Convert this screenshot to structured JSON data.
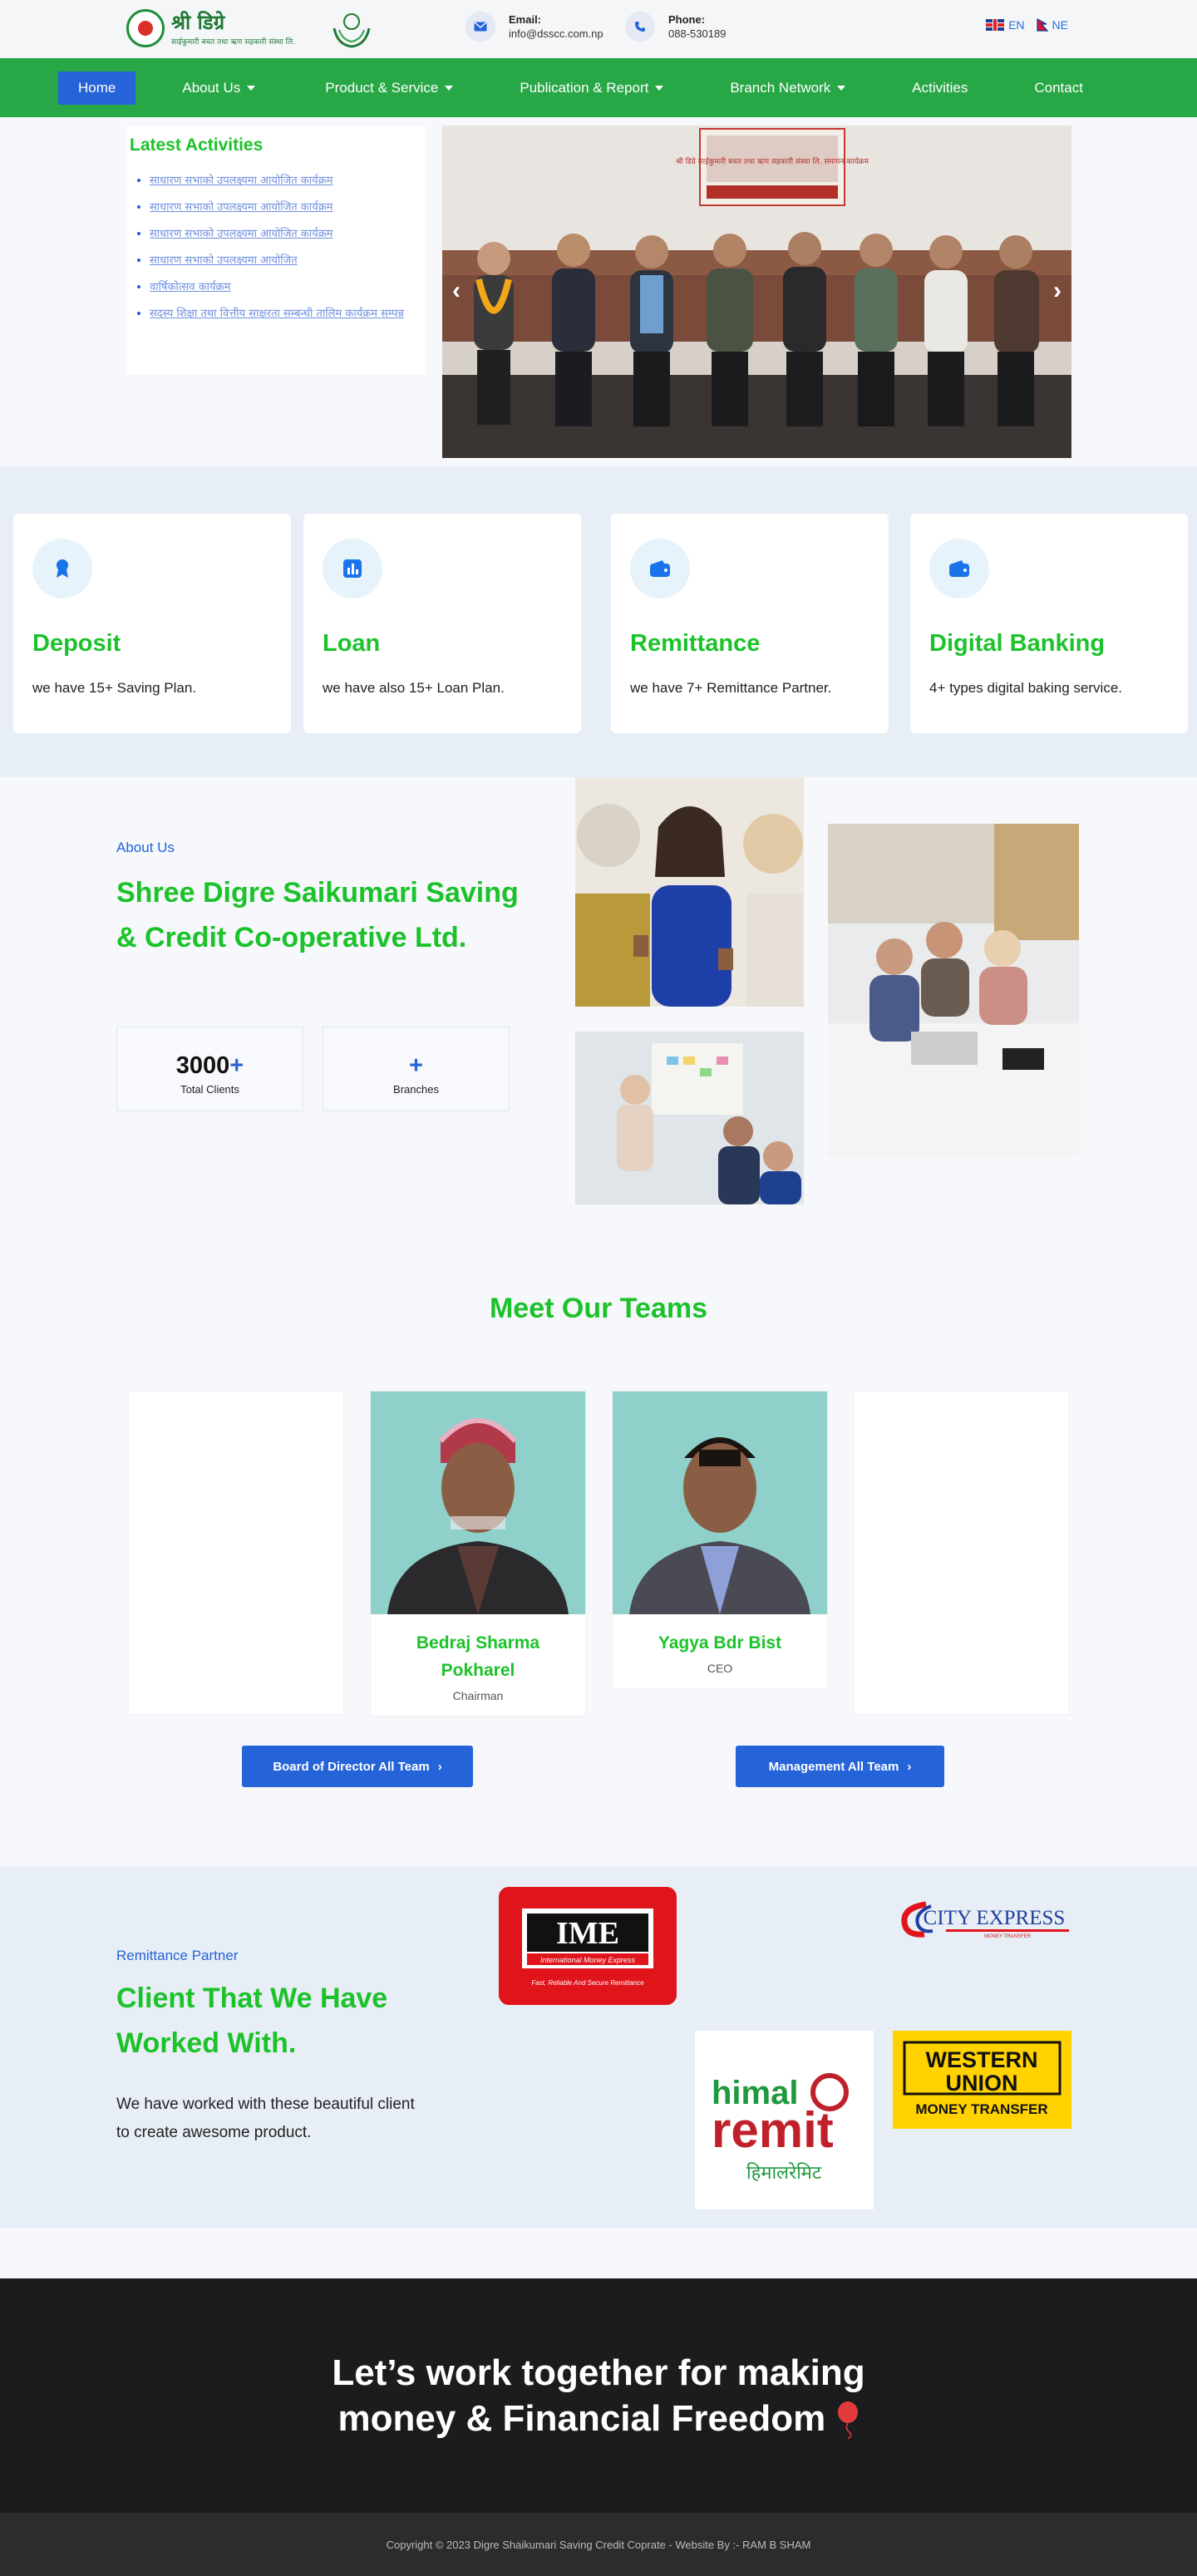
{
  "brand": {
    "name": "श्री डिग्रे",
    "tagline": "साईकुमारी बचत तथा ऋण सहकारी संस्था लि."
  },
  "contact": {
    "email_label": "Email:",
    "email_value": "info@dsscc.com.np",
    "phone_label": "Phone:",
    "phone_value": "088-530189"
  },
  "languages": [
    "EN",
    "NE"
  ],
  "nav": {
    "items": [
      {
        "label": "Home",
        "active": true
      },
      {
        "label": "About Us",
        "dropdown": true
      },
      {
        "label": "Product & Service",
        "dropdown": true
      },
      {
        "label": "Publication & Report",
        "dropdown": true
      },
      {
        "label": "Branch Network",
        "dropdown": true
      },
      {
        "label": "Activities"
      },
      {
        "label": "Contact"
      }
    ]
  },
  "hero": {
    "activities_title": "Latest Activities",
    "activities": [
      "साधारण सभाको उपलक्ष्यमा आयोजित कार्यक्रम",
      "साधारण सभाको उपलक्ष्यमा आयोजित कार्यक्रम",
      "साधारण सभाको उपलक्ष्यमा आयोजित कार्यक्रम",
      "साधारण सभाको उपलक्ष्यमा आयोजित",
      "वार्षिकोत्सव कार्यक्रम",
      "सदस्य शिक्षा तथा वित्तीय साक्षरता सम्बन्धी तालिम कार्यक्रम सम्पन्न"
    ],
    "banner_text": "श्री डिग्रे साईकुमारी बचत तथा ऋण सहकारी संस्था लि. समापन कार्यक्रम"
  },
  "services": [
    {
      "title": "Deposit",
      "desc": "we have 15+ Saving Plan.",
      "icon": "award-icon"
    },
    {
      "title": "Loan",
      "desc": "we have also 15+ Loan Plan.",
      "icon": "chart-icon"
    },
    {
      "title": "Remittance",
      "desc": "we have 7+ Remittance Partner.",
      "icon": "wallet-icon"
    },
    {
      "title": "Digital Banking",
      "desc": "4+ types digital baking service.",
      "icon": "wallet-icon"
    }
  ],
  "about": {
    "kicker": "About Us",
    "title": "Shree Digre Saikumari Saving & Credit Co-operative Ltd.",
    "stats": [
      {
        "value": "3000",
        "suffix": "+",
        "label": "Total Clients"
      },
      {
        "value": "",
        "suffix": "+",
        "label": "Branches"
      }
    ]
  },
  "teams": {
    "title": "Meet Our Teams",
    "members": [
      {
        "name": "Bedraj Sharma Pokharel",
        "role": "Chairman"
      },
      {
        "name": "Yagya Bdr Bist",
        "role": "CEO"
      }
    ],
    "board_button": "Board of Director All Team",
    "management_button": "Management All Team"
  },
  "partners": {
    "kicker": "Remittance Partner",
    "title": "Client That We Have Worked With.",
    "desc": "We have worked with these beautiful client to create awesome product.",
    "logos": {
      "ime_main": "IME",
      "ime_sub": "International Money Express",
      "ime_tag": "Fast, Reliable And Secure Remittance",
      "city_express": "CITY EXPRESS",
      "city_express_sub": "MONEY TRANSFER",
      "himal_top": "himal",
      "himal_main": "remit",
      "himal_dev": "हिमालरेमिट",
      "wu_line1": "WESTERN",
      "wu_line2": "UNION",
      "wu_line3": "MONEY TRANSFER"
    }
  },
  "cta": {
    "line1": "Let’s work together for making",
    "line2": "money & Financial Freedom"
  },
  "footer": {
    "copyright": "Copyright © 2023 Digre Shaikumari Saving Credit Coprate - Website By :- RAM B SHAM"
  },
  "colors": {
    "green_heading": "#1cc22a",
    "nav_green": "#27a745",
    "accent_blue": "#2563d9",
    "dark": "#1c1c1e"
  }
}
